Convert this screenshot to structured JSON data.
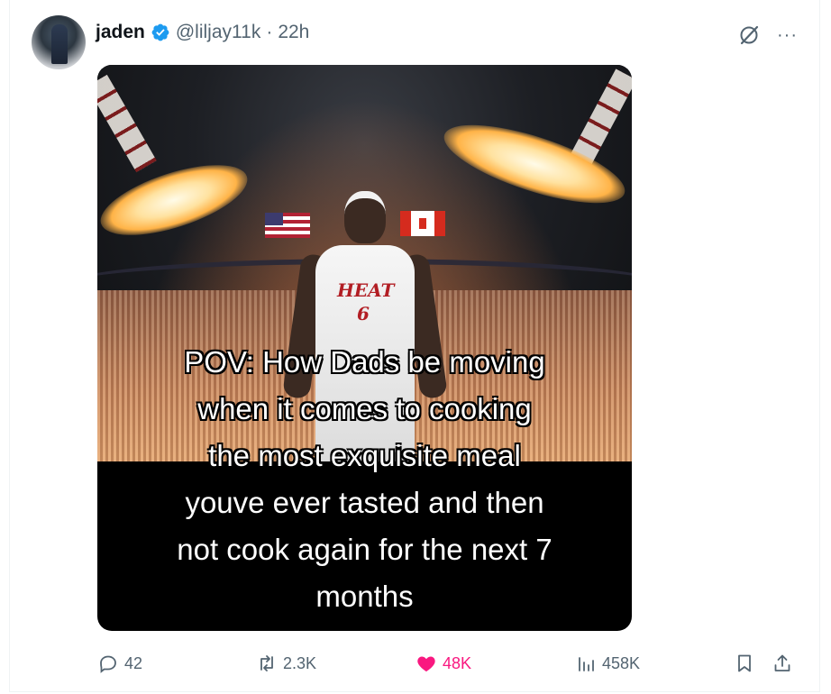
{
  "tweet": {
    "author_name": "jaden",
    "handle": "@liljay11k",
    "separator": "·",
    "time": "22h",
    "more_label": "···",
    "media": {
      "jersey_text": "HEAT",
      "jersey_number": "6",
      "caption_lines": [
        "POV: How Dads be moving",
        "when it comes to cooking",
        "the most exquisite meal",
        "youve ever tasted and then",
        "not cook again for the next 7",
        "months"
      ]
    },
    "stats": {
      "replies": "42",
      "reposts": "2.3K",
      "likes": "48K",
      "views": "458K"
    }
  },
  "colors": {
    "verified": "#1d9bf0",
    "like_active": "#f91880",
    "muted_text": "#536471"
  },
  "icons": [
    "verified-badge-icon",
    "grok-icon",
    "more-icon",
    "reply-icon",
    "repost-icon",
    "like-icon",
    "views-icon",
    "bookmark-icon",
    "share-icon"
  ]
}
